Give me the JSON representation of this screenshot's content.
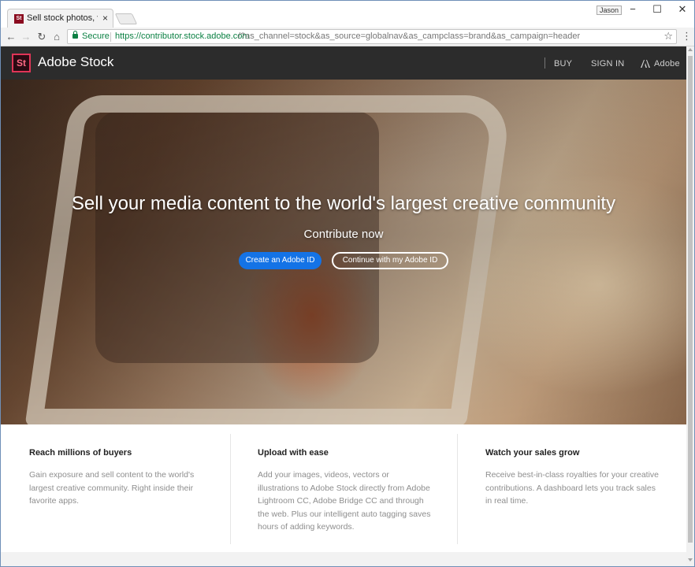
{
  "browser": {
    "tab_title": "Sell stock photos, videos",
    "tab_close": "×",
    "favicon_text": "St",
    "user_badge": "Jason",
    "window_controls": {
      "minimize": "−",
      "maximize": "☐",
      "close": "✕"
    },
    "nav": {
      "back": "←",
      "forward": "→",
      "reload": "↻",
      "home": "⌂"
    },
    "secure_label": "Secure",
    "url_host": "https://contributor.stock.adobe.com",
    "url_path": "/?as_channel=stock&as_source=globalnav&as_campclass=brand&as_campaign=header",
    "bookmark_icon": "☆",
    "menu_icon": "⋮"
  },
  "header": {
    "logo_text": "St",
    "brand": "Adobe Stock",
    "links": {
      "buy": "BUY",
      "sign_in": "SIGN IN",
      "adobe": "Adobe"
    }
  },
  "hero": {
    "title": "Sell your media content to the world's largest creative community",
    "subtitle": "Contribute now",
    "primary_button": "Create an Adobe ID",
    "secondary_button": "Continue with my Adobe ID"
  },
  "features": [
    {
      "title": "Reach millions of buyers",
      "body": "Gain exposure and sell content to the world's largest creative community. Right inside their favorite apps."
    },
    {
      "title": "Upload with ease",
      "body": "Add your images, videos, vectors or illustrations to Adobe Stock directly from Adobe Lightroom CC, Adobe Bridge CC and through the web. Plus our intelligent auto tagging saves hours of adding keywords."
    },
    {
      "title": "Watch your sales grow",
      "body": "Receive best-in-class royalties for your creative contributions. A dashboard lets you track sales in real time."
    }
  ],
  "colors": {
    "header_bg": "#2c2c2c",
    "primary_button": "#1473e6",
    "logo_accent": "#e03557",
    "secure_green": "#0b8043"
  }
}
